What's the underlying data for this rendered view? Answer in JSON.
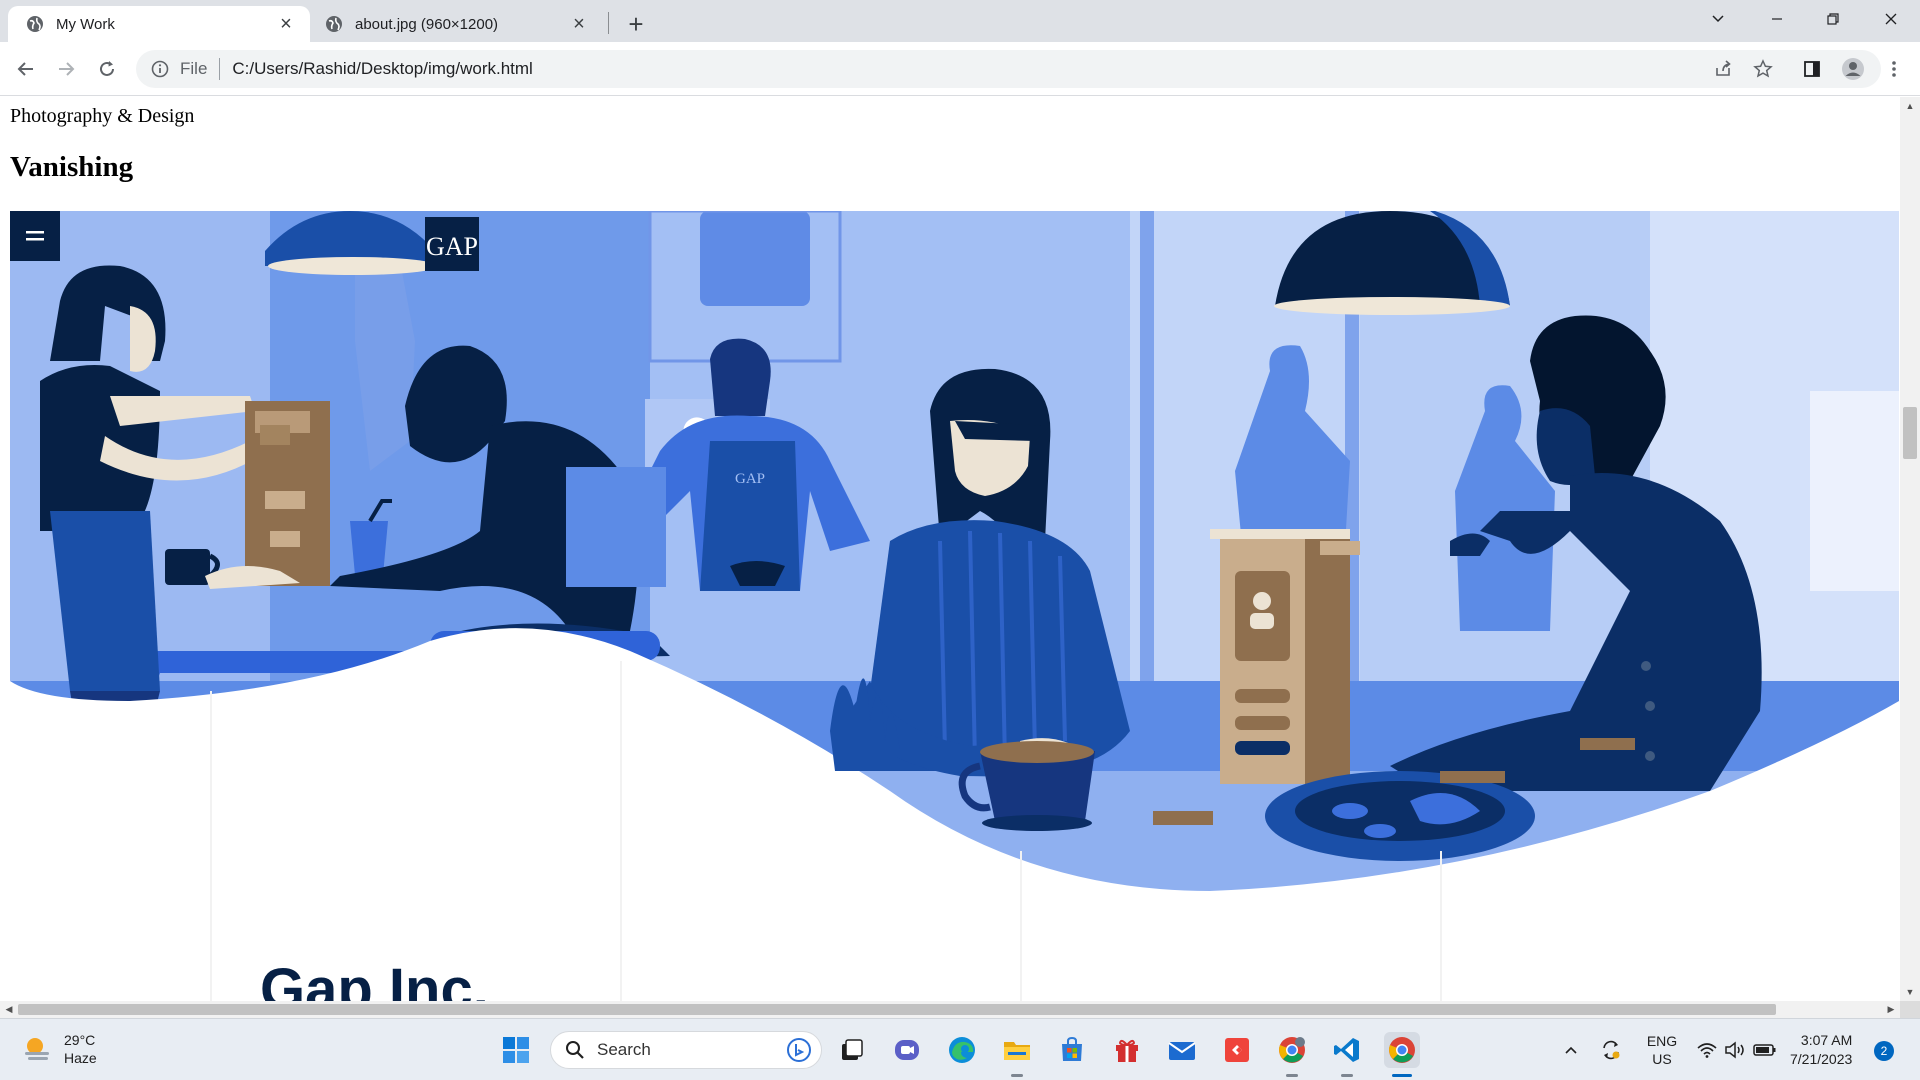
{
  "browser": {
    "tabs": [
      {
        "title": "My Work",
        "active": true
      },
      {
        "title": "about.jpg (960×1200)",
        "active": false
      }
    ],
    "address": {
      "scheme_label": "File",
      "url": "C:/Users/Rashid/Desktop/img/work.html"
    }
  },
  "page": {
    "subtitle": "Photography & Design",
    "heading": "Vanishing",
    "hero": {
      "logo_text": "GAP",
      "apron_text": "GAP",
      "caption": "Gap Inc."
    }
  },
  "taskbar": {
    "weather": {
      "temp": "29°C",
      "condition": "Haze"
    },
    "search_placeholder": "Search",
    "language": {
      "line1": "ENG",
      "line2": "US"
    },
    "clock": {
      "time": "3:07 AM",
      "date": "7/21/2023"
    },
    "notification_count": "2"
  },
  "colors": {
    "hero_light": "#a9c2f4",
    "hero_mid": "#5c8be6",
    "hero_dark": "#062045",
    "hero_navy": "#16367f",
    "skin": "#ece3d4",
    "wood": "#8f6f4e",
    "accent_blue": "#0067c0"
  }
}
